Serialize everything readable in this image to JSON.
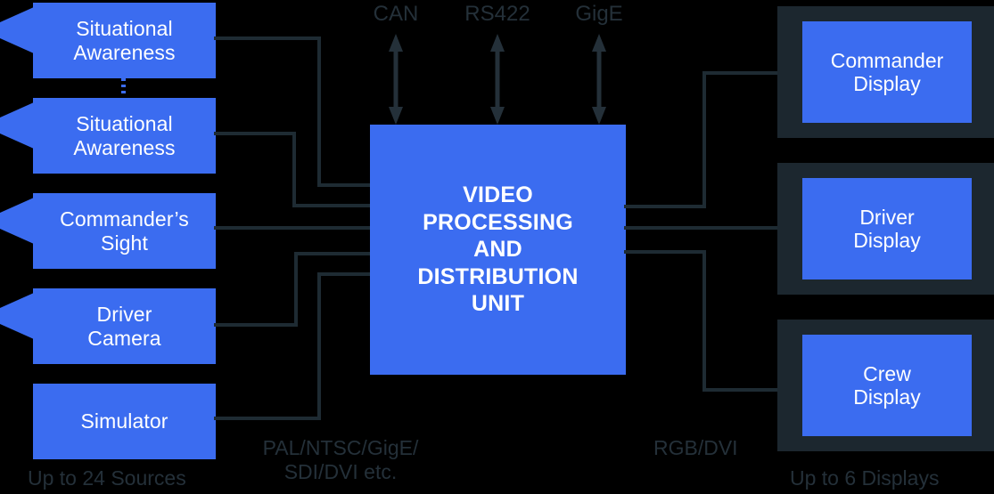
{
  "diagram": {
    "title": "Video Processing and Distribution Unit",
    "background_color": "#000000",
    "accent_color": "#3b6cf0",
    "wire_color": "#1e2b33",
    "caption_color": "#243039",
    "text_color": "#ffffff"
  },
  "sources": {
    "caption": "Up to 24 Sources",
    "format_caption": "PAL/NTSC/GigE/\nSDI/DVI etc.",
    "items": [
      {
        "label": "Situational\nAwareness",
        "has_cone": true
      },
      {
        "label": "Situational\nAwareness",
        "has_cone": true
      },
      {
        "label": "Commander’s\nSight",
        "has_cone": true
      },
      {
        "label": "Driver\nCamera",
        "has_cone": true
      },
      {
        "label": "Simulator",
        "has_cone": false
      }
    ]
  },
  "unit": {
    "label": "VIDEO\nPROCESSING\nAND\nDISTRIBUTION\nUNIT"
  },
  "buses": {
    "items": [
      {
        "label": "CAN",
        "direction": "bidirectional"
      },
      {
        "label": "RS422",
        "direction": "bidirectional"
      },
      {
        "label": "GigE",
        "direction": "bidirectional"
      }
    ]
  },
  "displays": {
    "caption": "Up to 6 Displays",
    "format_caption": "RGB/DVI",
    "items": [
      {
        "label": "Commander\nDisplay"
      },
      {
        "label": "Driver\nDisplay"
      },
      {
        "label": "Crew\nDisplay"
      }
    ]
  }
}
